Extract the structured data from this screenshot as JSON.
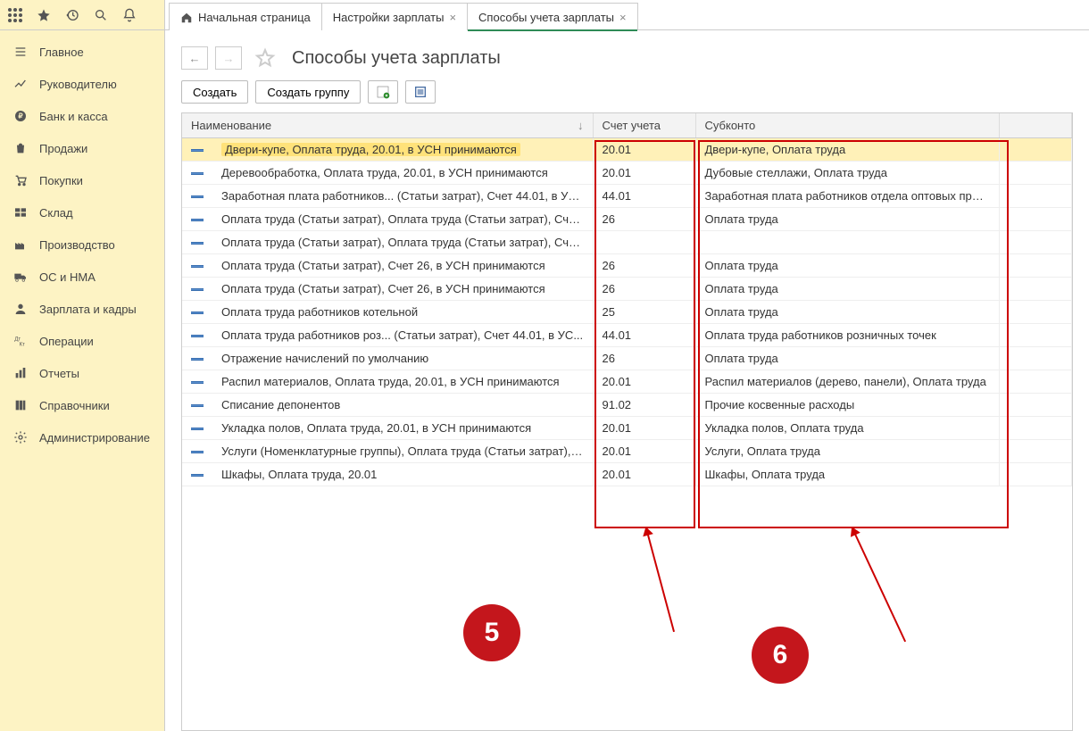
{
  "topbar_icons": [
    "apps-icon",
    "star-icon",
    "history-icon",
    "search-icon",
    "bell-icon"
  ],
  "tabs": [
    {
      "name": "home",
      "label": "Начальная страница",
      "home": true,
      "active": false
    },
    {
      "name": "settings",
      "label": "Настройки зарплаты",
      "close": true,
      "active": false
    },
    {
      "name": "methods",
      "label": "Способы учета зарплаты",
      "close": true,
      "active": true
    }
  ],
  "sidebar": [
    {
      "name": "main",
      "label": "Главное",
      "icon": "menu-icon"
    },
    {
      "name": "manager",
      "label": "Руководителю",
      "icon": "trend-icon"
    },
    {
      "name": "bank",
      "label": "Банк и касса",
      "icon": "ruble-icon"
    },
    {
      "name": "sales",
      "label": "Продажи",
      "icon": "bag-icon"
    },
    {
      "name": "purchases",
      "label": "Покупки",
      "icon": "cart-icon"
    },
    {
      "name": "warehouse",
      "label": "Склад",
      "icon": "boxes-icon"
    },
    {
      "name": "production",
      "label": "Производство",
      "icon": "factory-icon"
    },
    {
      "name": "os",
      "label": "ОС и НМА",
      "icon": "truck-icon"
    },
    {
      "name": "salary",
      "label": "Зарплата и кадры",
      "icon": "person-icon"
    },
    {
      "name": "operations",
      "label": "Операции",
      "icon": "dtkt-icon"
    },
    {
      "name": "reports",
      "label": "Отчеты",
      "icon": "bars-icon"
    },
    {
      "name": "refs",
      "label": "Справочники",
      "icon": "books-icon"
    },
    {
      "name": "admin",
      "label": "Администрирование",
      "icon": "gear-icon"
    }
  ],
  "page_title": "Способы учета зарплаты",
  "toolbar": {
    "create": "Создать",
    "create_group": "Создать группу"
  },
  "columns": {
    "name": "Наименование",
    "account": "Счет учета",
    "subkonto": "Субконто"
  },
  "rows": [
    {
      "name": "Двери-купе, Оплата труда, 20.01, в УСН принимаются",
      "account": "20.01",
      "subkonto": "Двери-купе, Оплата труда",
      "selected": true
    },
    {
      "name": "Деревообработка, Оплата труда, 20.01, в УСН принимаются",
      "account": "20.01",
      "subkonto": "Дубовые стеллажи, Оплата труда"
    },
    {
      "name": "Заработная плата работников... (Статьи затрат), Счет 44.01, в УС...",
      "account": "44.01",
      "subkonto": "Заработная плата работников отдела оптовых продаж"
    },
    {
      "name": "Оплата труда (Статьи затрат), Оплата труда (Статьи затрат), Счет...",
      "account": "26",
      "subkonto": "Оплата труда"
    },
    {
      "name": "Оплата труда (Статьи затрат), Оплата труда (Статьи затрат), Счет...",
      "account": "",
      "subkonto": ""
    },
    {
      "name": "Оплата труда (Статьи затрат), Счет 26, в УСН принимаются",
      "account": "26",
      "subkonto": "Оплата труда"
    },
    {
      "name": "Оплата труда (Статьи затрат), Счет 26, в УСН принимаются",
      "account": "26",
      "subkonto": "Оплата труда"
    },
    {
      "name": "Оплата труда работников котельной",
      "account": "25",
      "subkonto": "Оплата труда"
    },
    {
      "name": "Оплата труда работников роз... (Статьи затрат), Счет 44.01, в УС...",
      "account": "44.01",
      "subkonto": "Оплата труда работников розничных точек"
    },
    {
      "name": "Отражение начислений по умолчанию",
      "account": "26",
      "subkonto": "Оплата труда"
    },
    {
      "name": "Распил материалов, Оплата труда, 20.01, в УСН принимаются",
      "account": "20.01",
      "subkonto": "Распил материалов (дерево, панели), Оплата труда"
    },
    {
      "name": "Списание депонентов",
      "account": "91.02",
      "subkonto": "Прочие косвенные расходы"
    },
    {
      "name": "Укладка полов, Оплата труда, 20.01, в УСН принимаются",
      "account": "20.01",
      "subkonto": "Укладка полов, Оплата труда"
    },
    {
      "name": "Услуги (Номенклатурные группы), Оплата труда (Статьи затрат), ...",
      "account": "20.01",
      "subkonto": "Услуги, Оплата труда"
    },
    {
      "name": "Шкафы, Оплата труда, 20.01",
      "account": "20.01",
      "subkonto": "Шкафы, Оплата труда"
    }
  ],
  "annotations": {
    "five": "5",
    "six": "6"
  }
}
